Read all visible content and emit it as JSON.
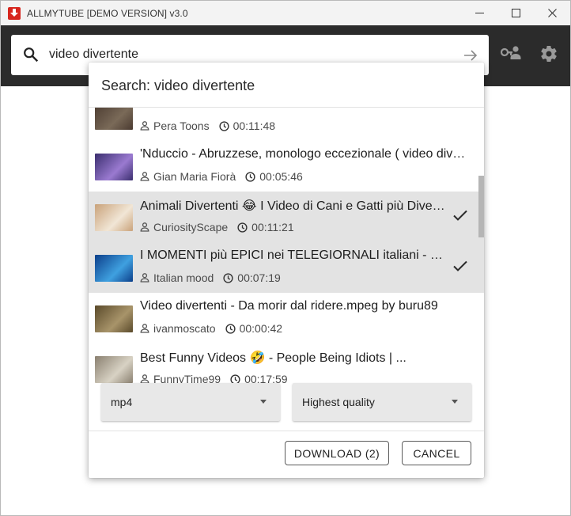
{
  "window": {
    "title": "ALLMYTUBE [DEMO VERSION]  v3.0",
    "minimize_glyph": "—",
    "maximize_glyph": "☐",
    "close_glyph": "✕"
  },
  "toolbar": {
    "search_value": "video divertente"
  },
  "popup": {
    "title": "Search: video divertente",
    "results": [
      {
        "title": "",
        "channel": "Pera Toons",
        "duration": "00:11:48",
        "selected": false,
        "thumb": [
          "#4a3a30",
          "#7a6a58"
        ]
      },
      {
        "title": "'Nduccio - Abruzzese, monologo eccezionale ( video divertente )",
        "channel": "Gian Maria Fiorà",
        "duration": "00:05:46",
        "selected": false,
        "thumb": [
          "#3a2e6e",
          "#9a7ad0"
        ]
      },
      {
        "title": "Animali Divertenti 😂 I Video di Cani e Gatti più Divertenti",
        "channel": "CuriosityScape",
        "duration": "00:11:21",
        "selected": true,
        "thumb": [
          "#c9a27a",
          "#f1e6d6"
        ]
      },
      {
        "title": "I MOMENTI più EPICI nei TELEGIORNALI italiani - prova",
        "channel": "Italian mood",
        "duration": "00:07:19",
        "selected": true,
        "thumb": [
          "#0c3f8a",
          "#3fa0e0"
        ]
      },
      {
        "title": "Video divertenti - Da morir dal ridere.mpeg by buru89",
        "channel": "ivanmoscato",
        "duration": "00:00:42",
        "selected": false,
        "thumb": [
          "#5a4a2a",
          "#a8946a"
        ]
      },
      {
        "title": "Best Funny Videos 🤣 - People Being Idiots | ...",
        "channel": "FunnyTime99",
        "duration": "00:17:59",
        "selected": false,
        "thumb": [
          "#8a8070",
          "#d8d2c4"
        ]
      }
    ],
    "format_select": "mp4",
    "quality_select": "Highest quality",
    "download_button": "DOWNLOAD (2)",
    "cancel_button": "CANCEL"
  },
  "colors": {
    "brand_red": "#d7261e",
    "toolbar_bg": "#2b2b2b",
    "selected_row": "#e3e3e3"
  },
  "icons": [
    "download-logo-icon",
    "minimize-icon",
    "maximize-icon",
    "close-icon",
    "search-icon",
    "arrow-right-icon",
    "key-user-icon",
    "gear-icon",
    "person-icon",
    "clock-icon",
    "check-icon",
    "dropdown-arrow-icon"
  ]
}
